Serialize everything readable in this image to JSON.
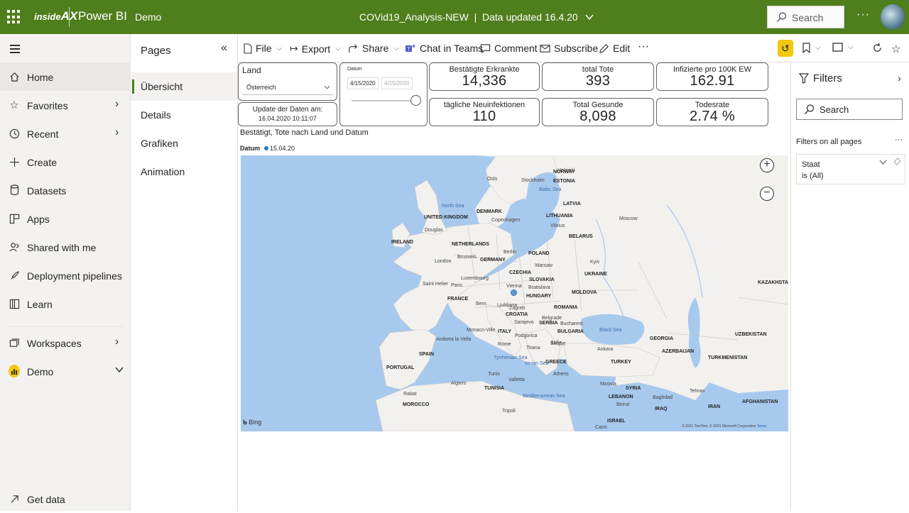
{
  "topbar": {
    "logo_small": "inside",
    "logo_big": "AX",
    "app": "Power BI",
    "workspace": "Demo",
    "report_title": "COVid19_Analysis-NEW",
    "data_updated": "Data updated 16.4.20",
    "search_placeholder": "Search",
    "more": "···"
  },
  "nav": {
    "items": [
      {
        "label": "Home",
        "icon": "home-icon"
      },
      {
        "label": "Favorites",
        "icon": "star-icon"
      },
      {
        "label": "Recent",
        "icon": "clock-icon"
      },
      {
        "label": "Create",
        "icon": "plus-icon"
      },
      {
        "label": "Datasets",
        "icon": "database-icon"
      },
      {
        "label": "Apps",
        "icon": "apps-icon"
      },
      {
        "label": "Shared with me",
        "icon": "person-share-icon"
      },
      {
        "label": "Deployment pipelines",
        "icon": "rocket-icon"
      },
      {
        "label": "Learn",
        "icon": "book-icon"
      },
      {
        "label": "Workspaces",
        "icon": "workspaces-icon"
      },
      {
        "label": "Demo",
        "icon": "powerbi-workspace-icon"
      },
      {
        "label": "Get data",
        "icon": "arrow-up-right-icon"
      }
    ]
  },
  "pages": {
    "title": "Pages",
    "items": [
      "Übersicht",
      "Details",
      "Grafiken",
      "Animation"
    ]
  },
  "toolbar": {
    "file": "File",
    "export": "Export",
    "share": "Share",
    "teams": "Chat in Teams",
    "comment": "Comment",
    "subscribe": "Subscribe",
    "edit": "Edit",
    "more": "···"
  },
  "slicers": {
    "land_label": "Land",
    "land_value": "Österreich",
    "datum_label": "Datum",
    "datum_from": "4/15/2020",
    "datum_to": "4/15/2020",
    "update_title": "Update der Daten am:",
    "update_value": "16.04.2020 10:11:07"
  },
  "kpis": [
    {
      "title": "Bestätigte Erkrankte",
      "value": "14,336"
    },
    {
      "title": "total Tote",
      "value": "393"
    },
    {
      "title": "Infizierte pro 100K EW",
      "value": "162.91"
    },
    {
      "title": "tägliche Neuinfektionen",
      "value": "110"
    },
    {
      "title": "Total Gesunde",
      "value": "8,098"
    },
    {
      "title": "Todesrate",
      "value": "2.74 %"
    }
  ],
  "map": {
    "title": "Bestätigt, Tote nach Land und Datum",
    "legend_label": "Datum",
    "legend_value": "15.04.20",
    "bing": "Bing",
    "attribution": "© 2021 TomTom, © 2021 Microsoft Corporation",
    "terms": "Terms",
    "countries": [
      "NORWAY",
      "ESTONIA",
      "LATVIA",
      "LITHUANIA",
      "DENMARK",
      "UNITED KINGDOM",
      "IRELAND",
      "NETHERLANDS",
      "BELARUS",
      "POLAND",
      "GERMANY",
      "CZECHIA",
      "SLOVAKIA",
      "UKRAINE",
      "FRANCE",
      "HUNGARY",
      "MOLDOVA",
      "ROMANIA",
      "CROATIA",
      "SERBIA",
      "BULGARIA",
      "ITALY",
      "SPAIN",
      "PORTUGAL",
      "GREECE",
      "TURKEY",
      "GEORGIA",
      "AZERBAIJAN",
      "KAZAKHSTAN",
      "UZBEKISTAN",
      "TURKMENISTAN",
      "SYRIA",
      "LEBANON",
      "ISRAEL",
      "IRAQ",
      "IRAN",
      "AFGHANISTAN",
      "TUNISIA",
      "MOROCCO"
    ],
    "cities": [
      "Helsinki",
      "Stockholm",
      "Oslo",
      "Copenhagen",
      "Vilnius",
      "Moscow",
      "Douglas",
      "London",
      "Brussels",
      "Luxembourg",
      "Paris",
      "Berlin",
      "Warsaw",
      "Kyiv",
      "Vienna",
      "Bratislava",
      "Ljubljana",
      "Zagreb",
      "Sarajevo",
      "Belgrade",
      "Podgorica",
      "Sofia",
      "Bucharest",
      "Skopje",
      "Tirana",
      "Athens",
      "Ankara",
      "Nicosia",
      "Beirut",
      "Baghdad",
      "Tehran",
      "Rome",
      "Tunis",
      "Algiers",
      "Rabat",
      "Andorra la Vella",
      "Monaco-Ville",
      "Valletta",
      "Tripoli",
      "Saint Helier",
      "Bern",
      "Cairo"
    ],
    "seas": [
      "North Sea",
      "Baltic Sea",
      "Black Sea",
      "Tyrrhenian Sea",
      "Ionian Sea",
      "Mediterranean Sea"
    ]
  },
  "filters": {
    "title": "Filters",
    "search_placeholder": "Search",
    "all_pages": "Filters on all pages",
    "all_more": "···",
    "card_field": "Staat",
    "card_value": "is (All)"
  }
}
